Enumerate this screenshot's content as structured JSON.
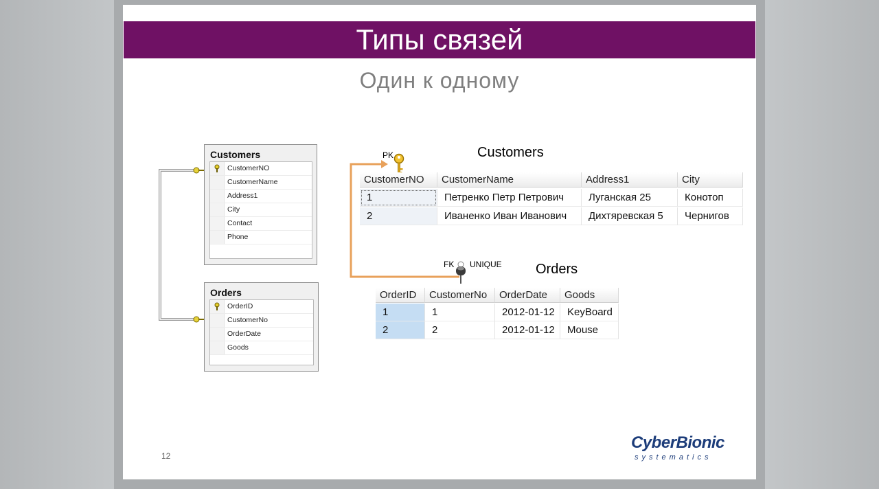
{
  "slide": {
    "title": "Типы связей",
    "subtitle": "Один к одному",
    "page_number": "12"
  },
  "designer": {
    "customers": {
      "title": "Customers",
      "columns": [
        "CustomerNO",
        "CustomerName",
        "Address1",
        "City",
        "Contact",
        "Phone"
      ]
    },
    "orders": {
      "title": "Orders",
      "columns": [
        "OrderID",
        "CustomerNo",
        "OrderDate",
        "Goods"
      ]
    }
  },
  "customers_grid": {
    "label": "Customers",
    "pk_label": "PK",
    "headers": [
      "CustomerNO",
      "CustomerName",
      "Address1",
      "City"
    ],
    "rows": [
      [
        "1",
        "Петренко Петр Петрович",
        "Луганская 25",
        "Конотоп"
      ],
      [
        "2",
        "Иваненко Иван Иванович",
        "Дихтяревская 5",
        "Чернигов"
      ]
    ]
  },
  "orders_grid": {
    "label": "Orders",
    "fk_label": "FK",
    "unique_label": "UNIQUE",
    "headers": [
      "OrderID",
      "CustomerNo",
      "OrderDate",
      "Goods"
    ],
    "rows": [
      [
        "1",
        "1",
        "2012-01-12",
        "KeyBoard"
      ],
      [
        "2",
        "2",
        "2012-01-12",
        "Mouse"
      ]
    ]
  },
  "logo": {
    "brand": "CyberBionic",
    "tagline": "systematics"
  },
  "colors": {
    "title_bar": "#6f1164",
    "relation_arrow": "#e8a15b",
    "logo": "#1d3d7a"
  }
}
